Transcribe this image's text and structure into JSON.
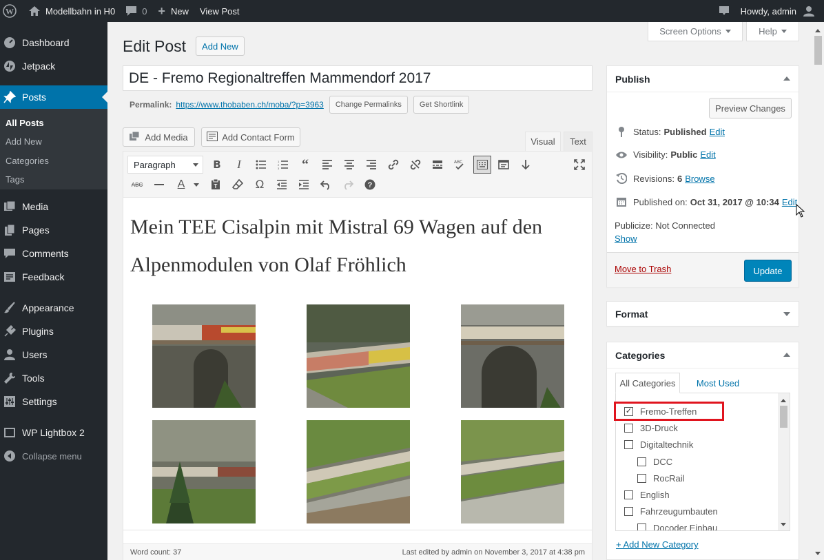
{
  "admin_bar": {
    "site_name": "Modellbahn in H0",
    "comments_count": "0",
    "new_label": "New",
    "view_post": "View Post",
    "howdy": "Howdy, admin"
  },
  "sidebar": {
    "items": [
      {
        "label": "Dashboard",
        "icon": "dashboard-icon"
      },
      {
        "label": "Jetpack",
        "icon": "jetpack-icon"
      },
      {
        "label": "Posts",
        "icon": "pin-icon"
      },
      {
        "label": "Media",
        "icon": "media-icon"
      },
      {
        "label": "Pages",
        "icon": "pages-icon"
      },
      {
        "label": "Comments",
        "icon": "comment-icon"
      },
      {
        "label": "Feedback",
        "icon": "feedback-icon"
      },
      {
        "label": "Appearance",
        "icon": "brush-icon"
      },
      {
        "label": "Plugins",
        "icon": "plugin-icon"
      },
      {
        "label": "Users",
        "icon": "user-icon"
      },
      {
        "label": "Tools",
        "icon": "wrench-icon"
      },
      {
        "label": "Settings",
        "icon": "settings-icon"
      },
      {
        "label": "WP Lightbox 2",
        "icon": "lightbox-icon"
      },
      {
        "label": "Collapse menu",
        "icon": "collapse-icon"
      }
    ],
    "posts_sub": [
      "All Posts",
      "Add New",
      "Categories",
      "Tags"
    ]
  },
  "screen_options": "Screen Options",
  "help": "Help",
  "page": {
    "title": "Edit Post",
    "add_new": "Add New",
    "post_title": "DE - Fremo Regionaltreffen Mammendorf 2017",
    "permalink_label": "Permalink:",
    "permalink_url": "https://www.thobaben.ch/moba/?p=3963",
    "change_permalinks": "Change Permalinks",
    "get_shortlink": "Get Shortlink",
    "add_media": "Add Media",
    "add_contact_form": "Add Contact Form",
    "tab_visual": "Visual",
    "tab_text": "Text",
    "format_select": "Paragraph",
    "content_heading": "Mein TEE Cisalpin mit Mistral 69 Wagen auf den Alpenmodulen von Olaf Fröhlich",
    "word_count": "Word count: 37",
    "last_edited": "Last edited by admin on November 3, 2017 at 4:38 pm"
  },
  "publish": {
    "title": "Publish",
    "preview": "Preview Changes",
    "status_label": "Status:",
    "status_value": "Published",
    "visibility_label": "Visibility:",
    "visibility_value": "Public",
    "revisions_label": "Revisions:",
    "revisions_value": "6",
    "browse": "Browse",
    "published_on_label": "Published on:",
    "published_on_value": "Oct 31, 2017 @ 10:34",
    "edit": "Edit",
    "publicize": "Publicize: Not Connected",
    "show": "Show",
    "trash": "Move to Trash",
    "update": "Update"
  },
  "format_box": {
    "title": "Format"
  },
  "categories": {
    "title": "Categories",
    "tab_all": "All Categories",
    "tab_most_used": "Most Used",
    "items": [
      {
        "label": "Fremo-Treffen",
        "checked": true
      },
      {
        "label": "3D-Druck",
        "checked": false
      },
      {
        "label": "Digitaltechnik",
        "checked": false
      },
      {
        "label": "DCC",
        "checked": false
      },
      {
        "label": "RocRail",
        "checked": false
      },
      {
        "label": "English",
        "checked": false
      },
      {
        "label": "Fahrzeugumbauten",
        "checked": false
      },
      {
        "label": "Docoder Einbau",
        "checked": false
      }
    ],
    "add_new": "+ Add New Category"
  },
  "colors": {
    "accent": "#0073aa",
    "highlight": "#e0141e",
    "trash": "#a00"
  }
}
